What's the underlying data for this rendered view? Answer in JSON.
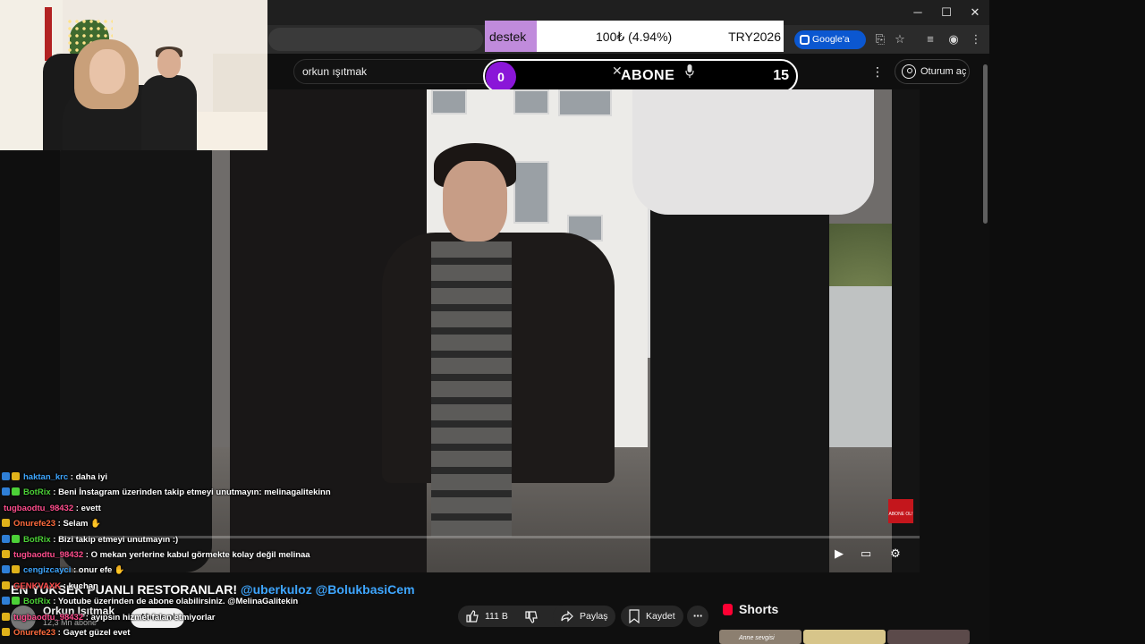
{
  "donation": {
    "label": "destek",
    "amount": "100₺ (4.94%)",
    "code": "TRY2026",
    "progress_fraction": 0.0494
  },
  "browser": {
    "google_button": "Google'a Sor",
    "win_min": "─",
    "win_max": "☐",
    "win_close": "✕"
  },
  "youtube": {
    "search_value": "orkun ışıtmak",
    "signin_label": "Oturum aç",
    "more_glyph": "⋮"
  },
  "sub_goal": {
    "current": "0",
    "title": "ABONE",
    "target": "15",
    "close_glyph": "✕"
  },
  "video": {
    "title_prefix": "EN YÜKSEK PUANLI RESTORANLAR!",
    "tag1": "@uberkuloz",
    "tag2": "@BolukbasiCem",
    "badge_text": "ABONE OL!"
  },
  "channel": {
    "name": "Orkun Işıtmak",
    "subs": "12,3 Mn abone",
    "subscribe": "Abone ol"
  },
  "actions": {
    "likes": "111 B",
    "share": "Paylaş",
    "save": "Kaydet"
  },
  "shorts": {
    "title": "Shorts",
    "thumb_caption": "Anne sevgisi"
  },
  "chat": [
    {
      "user": "haktan_krc",
      "color": "#3ea6ff",
      "badges": [
        "#2f7fd6",
        "#e0b21a"
      ],
      "msg": ": daha iyi"
    },
    {
      "user": "BotRix",
      "color": "#4cd137",
      "badges": [
        "#2f7fd6",
        "#4cd137"
      ],
      "msg": ": Beni İnstagram üzerinden takip etmeyi unutmayın: melinagalitekinn"
    },
    {
      "user": "tugbaodtu_98432",
      "color": "#ff4d8d",
      "badges": [],
      "msg": ": evett"
    },
    {
      "user": "Onurefe23",
      "color": "#ff6b3d",
      "badges": [
        "#e0b21a"
      ],
      "msg": ": Selam ✋"
    },
    {
      "user": "BotRix",
      "color": "#4cd137",
      "badges": [
        "#2f7fd6",
        "#4cd137"
      ],
      "msg": ": Bizi takip etmeyi unutmayın :)"
    },
    {
      "user": "tugbaodtu_98432",
      "color": "#ff4d8d",
      "badges": [
        "#e0b21a"
      ],
      "msg": ": O mekan yerlerine kabul görmekte kolay değil melinaa"
    },
    {
      "user": "cengizcayci",
      "color": "#3ea6ff",
      "badges": [
        "#2f7fd6",
        "#e0b21a"
      ],
      "msg": ": onur efe ✋"
    },
    {
      "user": "GENKVAXK",
      "color": "#ff4d4d",
      "badges": [
        "#e0b21a"
      ],
      "msg": ": kuchan"
    },
    {
      "user": "BotRix",
      "color": "#4cd137",
      "badges": [
        "#2f7fd6",
        "#4cd137"
      ],
      "msg": ": Youtube üzerinden de abone olabilirsiniz. @MelinaGalitekin"
    },
    {
      "user": "tugbaodtu_98432",
      "color": "#ff4d8d",
      "badges": [
        "#e0b21a"
      ],
      "msg": ": ayıpsın hizmet falan etmiyorlar"
    },
    {
      "user": "Onurefe23",
      "color": "#ff6b3d",
      "badges": [
        "#e0b21a"
      ],
      "msg": ": Gayet güzel evet"
    }
  ]
}
